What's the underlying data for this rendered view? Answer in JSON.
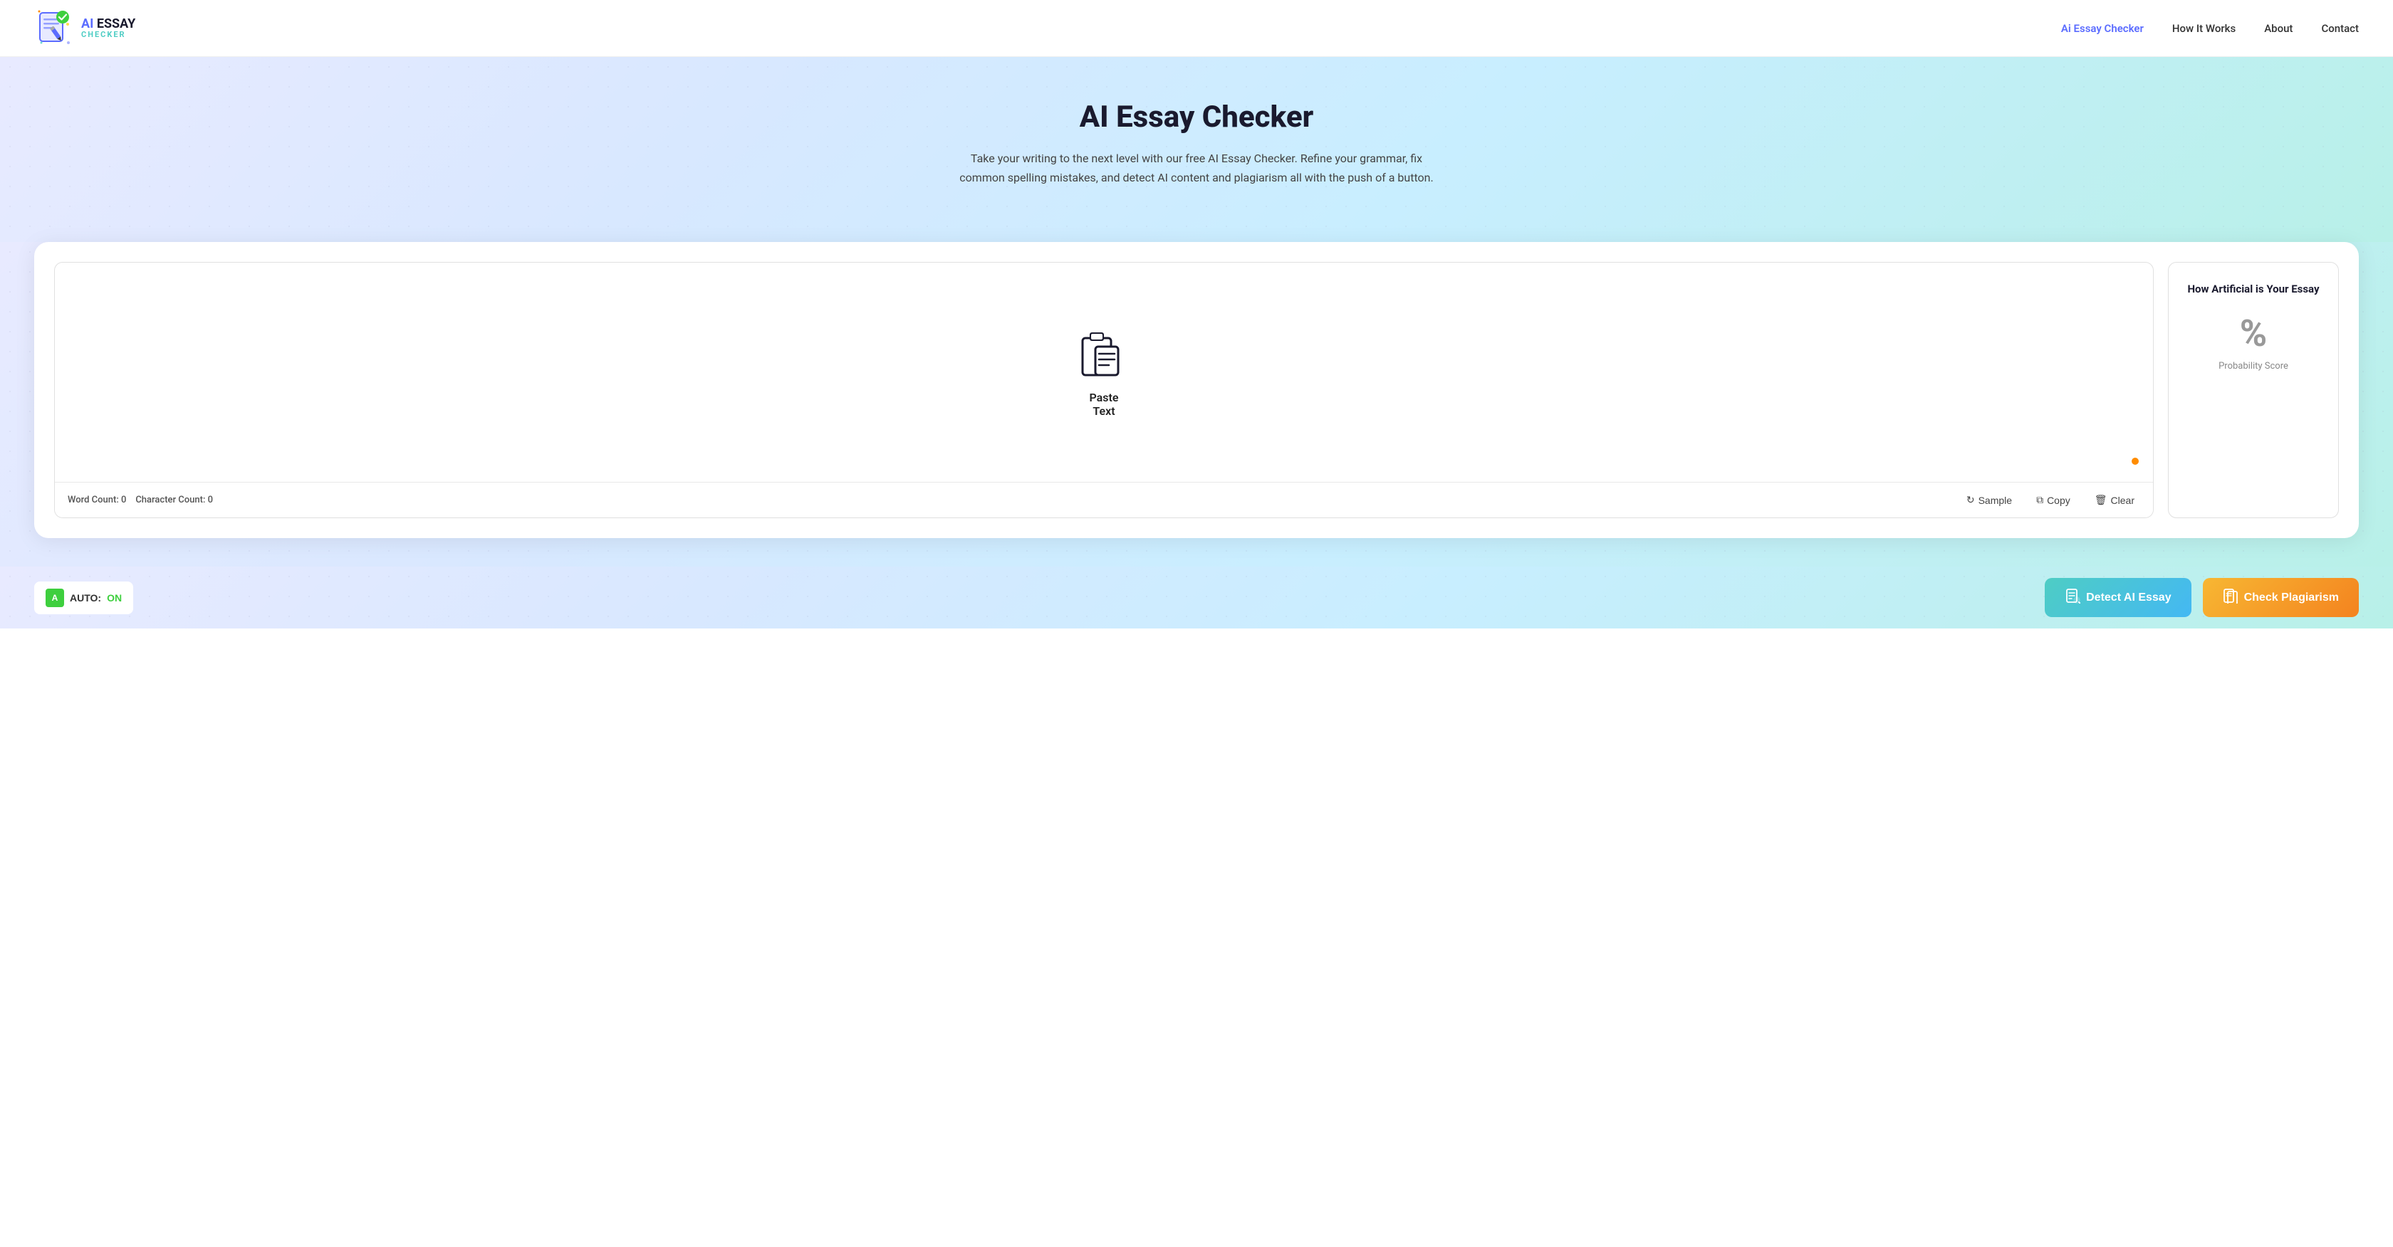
{
  "header": {
    "logo": {
      "ai_text": "AI ",
      "essay_text": "ESSAY",
      "checker_text": "CHECKER"
    },
    "nav": {
      "items": [
        {
          "label": "Ai Essay Checker",
          "active": true
        },
        {
          "label": "How It Works",
          "active": false
        },
        {
          "label": "About",
          "active": false
        },
        {
          "label": "Contact",
          "active": false
        }
      ]
    }
  },
  "hero": {
    "title": "AI Essay Checker",
    "subtitle": "Take your writing to the next level with our free AI Essay Checker. Refine your grammar, fix common spelling mistakes, and detect AI content and plagiarism all with the push of a button."
  },
  "editor": {
    "paste_label_line1": "Paste",
    "paste_label_line2": "Text",
    "word_count_label": "Word Count: 0",
    "char_count_label": "Character Count: 0",
    "sample_btn": "Sample",
    "copy_btn": "Copy",
    "clear_btn": "Clear"
  },
  "score_panel": {
    "title": "How Artificial is Your Essay",
    "percent_symbol": "%",
    "prob_label": "Probability Score"
  },
  "toolbar": {
    "auto_label": "AUTO:",
    "auto_status": "ON",
    "detect_btn": "Detect AI Essay",
    "plagiarism_btn": "Check Plagiarism"
  }
}
